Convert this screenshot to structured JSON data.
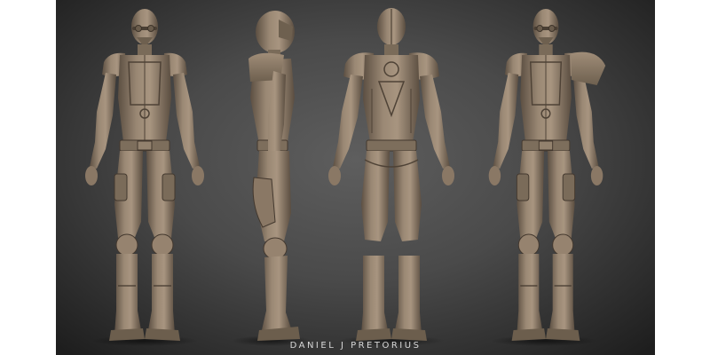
{
  "image": {
    "kind": "3D character sculpt turnaround render",
    "background_colors": [
      "#5e5e5e",
      "#1e1e1e"
    ],
    "model_color": "#8d7b68",
    "views": [
      "front",
      "side",
      "back",
      "three-quarter"
    ]
  },
  "credit": {
    "text": "DANIEL J PRETORIUS"
  }
}
